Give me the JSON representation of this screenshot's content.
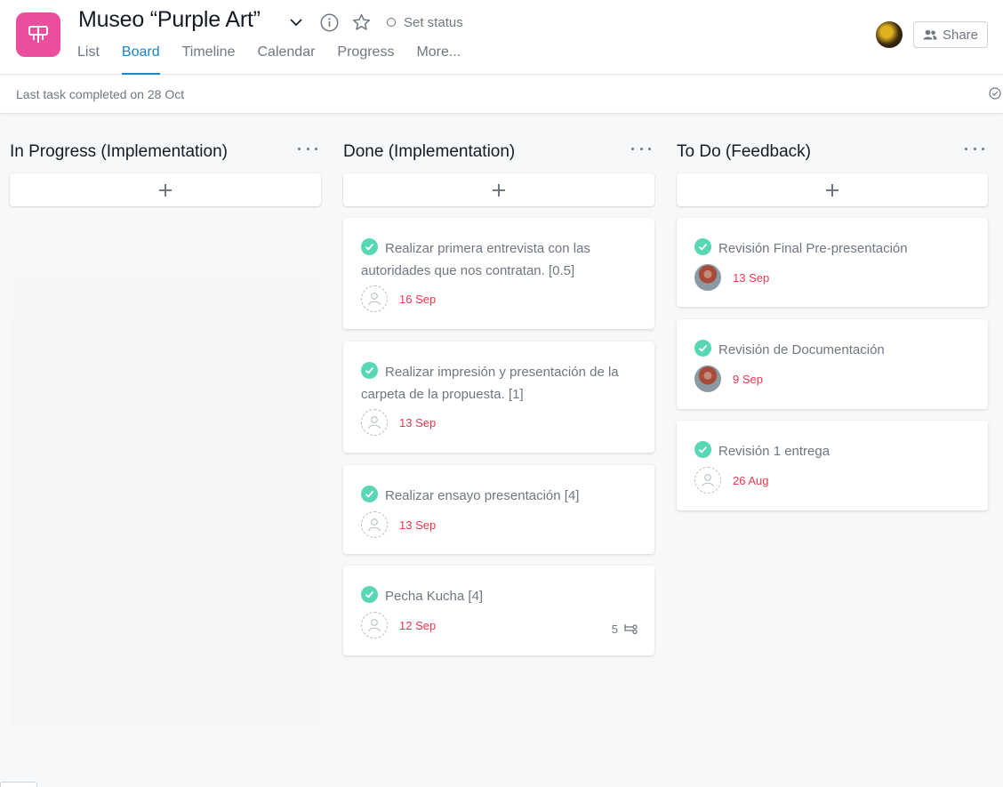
{
  "header": {
    "project_title": "Museo “Purple Art”",
    "set_status": "Set status",
    "share_label": "Share",
    "icon_color": "#ea4e9d"
  },
  "tabs": [
    {
      "label": "List",
      "active": false
    },
    {
      "label": "Board",
      "active": true
    },
    {
      "label": "Timeline",
      "active": false
    },
    {
      "label": "Calendar",
      "active": false
    },
    {
      "label": "Progress",
      "active": false
    },
    {
      "label": "More..."
    }
  ],
  "subbar": {
    "text": "Last task completed on 28 Oct"
  },
  "columns": [
    {
      "title": "In Progress (Implementation)",
      "cards": []
    },
    {
      "title": "Done (Implementation)",
      "cards": [
        {
          "title": "Realizar primera entrevista con las autoridades que nos contratan. [0.5]",
          "due": "16 Sep"
        },
        {
          "title": "Realizar impresión y presentación de la carpeta de la propuesta. [1]",
          "due": "13 Sep"
        },
        {
          "title": "Realizar ensayo presentación [4]",
          "due": "13 Sep"
        },
        {
          "title": "Pecha Kucha [4]",
          "due": "12 Sep",
          "subtasks": "5"
        }
      ]
    },
    {
      "title": "To Do (Feedback)",
      "cards": [
        {
          "title": "Revisión Final Pre-presentación",
          "due": "13 Sep"
        },
        {
          "title": "Revisión de Documentación",
          "due": "9 Sep"
        },
        {
          "title": "Revisión 1 entrega",
          "due": "26 Aug"
        }
      ]
    }
  ],
  "colors": {
    "accent": "#1b84c6",
    "complete_check": "#58d7b5",
    "due_date": "#e8384f"
  }
}
